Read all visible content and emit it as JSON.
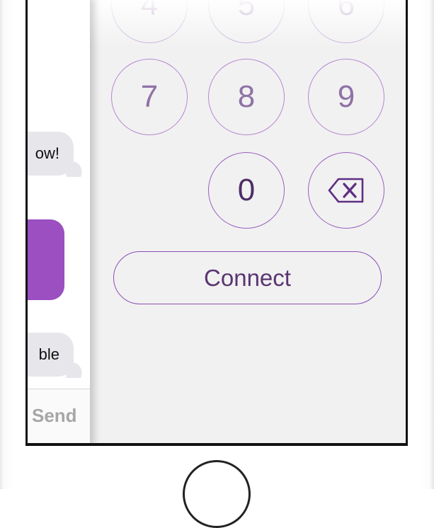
{
  "keypad": {
    "row_top": [
      "4",
      "5",
      "6"
    ],
    "row_789": [
      "7",
      "8",
      "9"
    ],
    "zero": "0",
    "delete_icon": "backspace-icon"
  },
  "connect_button": {
    "label": "Connect"
  },
  "messages": {
    "bubble_1": "ow!",
    "bubble_2": "ble",
    "send_label": "Send"
  },
  "colors": {
    "accent": "#8d4db8",
    "key_text": "#6e4a8a",
    "bubble_gray": "#e6e6eb",
    "bubble_purple": "#9b4fc0",
    "send_gray": "#a6a6a6"
  }
}
